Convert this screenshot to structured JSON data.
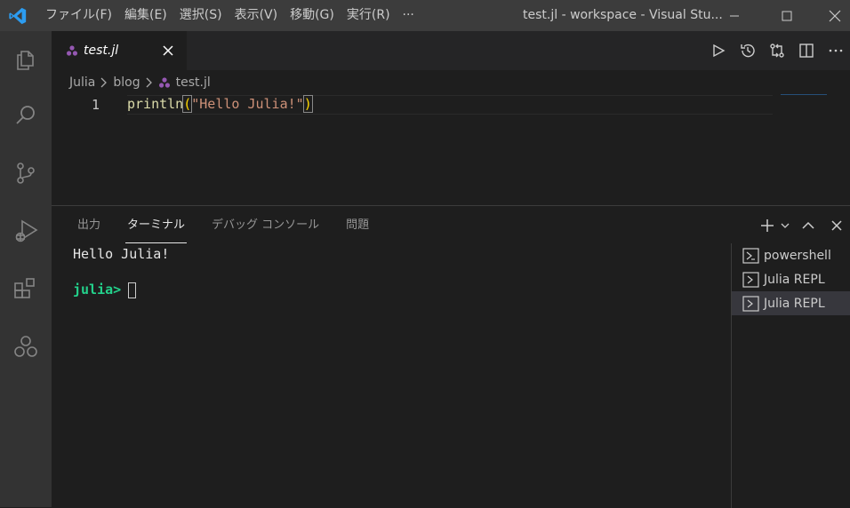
{
  "titlebar": {
    "menu": [
      "ファイル(F)",
      "編集(E)",
      "選択(S)",
      "表示(V)",
      "移動(G)",
      "実行(R)",
      "···"
    ],
    "window_title": "test.jl - workspace - Visual Stu..."
  },
  "tabs": [
    {
      "label": "test.jl",
      "active": true
    }
  ],
  "breadcrumb": [
    "Julia",
    "blog",
    "test.jl"
  ],
  "editor": {
    "line_numbers": [
      "1"
    ],
    "code_fn": "println",
    "code_open": "(",
    "code_string": "\"Hello Julia!\"",
    "code_close": ")"
  },
  "panel": {
    "tabs": [
      "出力",
      "ターミナル",
      "デバッグ コンソール",
      "問題"
    ],
    "active_tab": "ターミナル"
  },
  "terminal": {
    "output": "Hello Julia!",
    "prompt": "julia>"
  },
  "terminal_list": [
    "powershell",
    "Julia REPL",
    "Julia REPL"
  ],
  "colors": {
    "accent": "#007acc",
    "julia_purple": "#9558b2",
    "prompt_green": "#23d18b",
    "string": "#ce9178",
    "function": "#dcdcaa"
  }
}
